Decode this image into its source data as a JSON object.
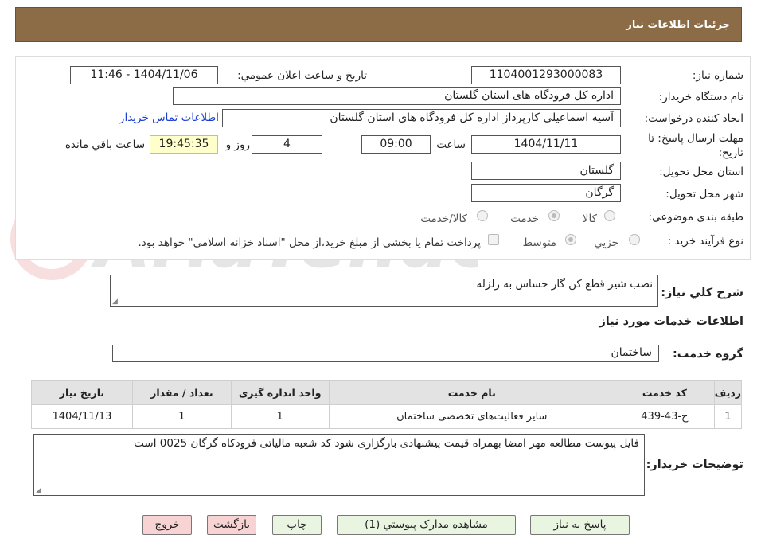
{
  "header": {
    "title": "جزئيات اطلاعات نياز"
  },
  "form": {
    "need_number_label": "شماره نياز:",
    "need_number": "1104001293000083",
    "announce_label": "تاريخ و ساعت اعلان عمومي:",
    "announce_value": "1404/11/06 - 11:46",
    "buyer_org_label": "نام دستگاه خريدار:",
    "buyer_org": "اداره کل فرودگاه های استان گلستان",
    "creator_label": "ايجاد کننده درخواست:",
    "creator": "آسیه اسماعیلی کارپرداز اداره کل فرودگاه های استان گلستان",
    "contact_link": "اطلاعات تماس خريدار",
    "deadline_label_1": "مهلت ارسال پاسخ: تا",
    "deadline_label_2": "تاريخ:",
    "deadline_date": "1404/11/11",
    "time_label": "ساعت",
    "deadline_time": "09:00",
    "days_value": "4",
    "days_label": "روز و",
    "remaining_time": "19:45:35",
    "remaining_label": "ساعت باقي مانده",
    "province_label": "استان محل تحويل:",
    "province": "گلستان",
    "city_label": "شهر محل تحويل:",
    "city": "گرگان",
    "category_label": "طبقه بندی موضوعی:",
    "category_goods": "کالا",
    "category_service": "خدمت",
    "category_goods_service": "کالا/خدمت",
    "process_label": "نوع فرآيند خريد :",
    "process_partial": "جزيي",
    "process_medium": "متوسط",
    "payment_note": "پرداخت تمام يا بخشی از مبلغ خريد،از محل \"اسناد خزانه اسلامی\" خواهد بود."
  },
  "description": {
    "label": "شرح کلي نياز:",
    "value": "نصب شیر قطع کن گاز حساس به زلزله"
  },
  "services": {
    "section_title": "اطلاعات خدمات مورد نياز",
    "group_label": "گروه خدمت:",
    "group_value": "ساختمان",
    "headers": [
      "رديف",
      "کد خدمت",
      "نام خدمت",
      "واحد اندازه گيری",
      "تعداد / مقدار",
      "تاريخ نياز"
    ],
    "rows": [
      [
        "1",
        "ج-43-439",
        "ساير فعاليت‌های تخصصی ساختمان",
        "1",
        "1",
        "1404/11/13"
      ]
    ]
  },
  "buyer_notes": {
    "label": "توضيحات خريدار:",
    "value": "فایل پیوست مطالعه مهر امضا بهمراه قیمت پیشنهادی بارگزاری شود کد شعبه مالیاتی فرودکاه گرگان 0025 است"
  },
  "buttons": {
    "reply": "پاسخ به نياز",
    "attachments": "مشاهده مدارک پيوستي (1)",
    "print": "چاپ",
    "back": "بازگشت",
    "exit": "خروج"
  },
  "colors": {
    "header_bg": "#8b6c46",
    "button_green": "#e9f5e1",
    "button_red": "#f7d3d3",
    "highlight": "#ffffcc",
    "link": "#1a3fd1"
  }
}
